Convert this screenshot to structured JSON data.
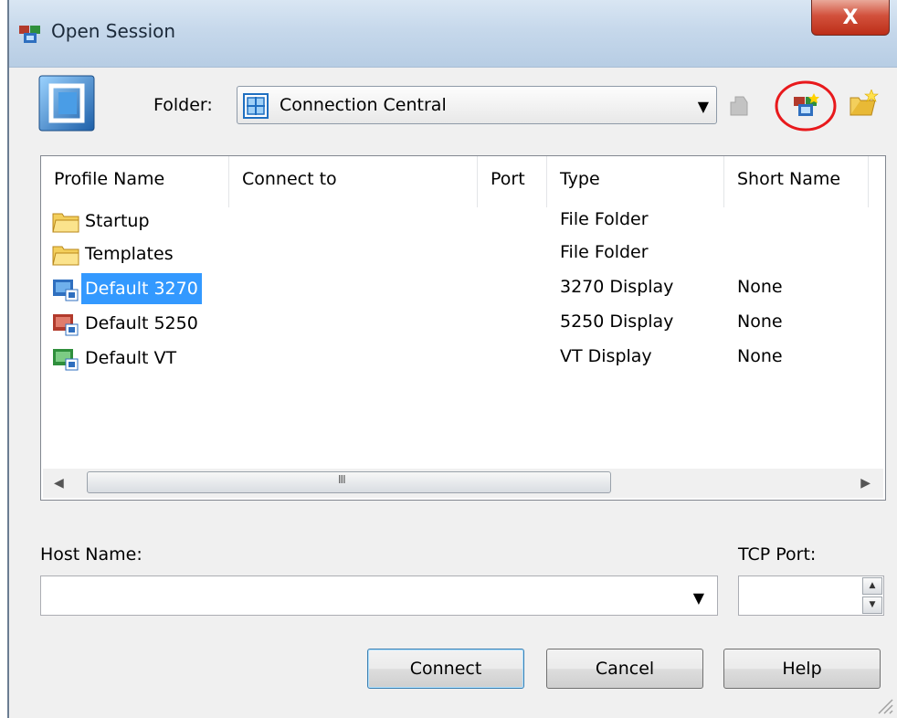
{
  "window": {
    "title": "Open Session",
    "close_label": "X"
  },
  "folder": {
    "label": "Folder:",
    "selected": "Connection Central"
  },
  "toolbar": {
    "icons": [
      "up-folder-icon",
      "new-session-icon",
      "new-folder-icon"
    ],
    "highlighted": "new-session-icon",
    "highlight_color": "#e8191c"
  },
  "list": {
    "columns": [
      "Profile Name",
      "Connect to",
      "Port",
      "Type",
      "Short Name"
    ],
    "rows": [
      {
        "name": "Startup",
        "connect_to": "",
        "port": "",
        "type": "File Folder",
        "short_name": "",
        "icon": "folder-icon"
      },
      {
        "name": "Templates",
        "connect_to": "",
        "port": "",
        "type": "File Folder",
        "short_name": "",
        "icon": "folder-icon"
      },
      {
        "name": "Default 3270",
        "connect_to": "",
        "port": "",
        "type": "3270 Display",
        "short_name": "None",
        "icon": "session-3270-icon",
        "selected": true
      },
      {
        "name": "Default 5250",
        "connect_to": "",
        "port": "",
        "type": "5250 Display",
        "short_name": "None",
        "icon": "session-5250-icon"
      },
      {
        "name": "Default VT",
        "connect_to": "",
        "port": "",
        "type": "VT Display",
        "short_name": "None",
        "icon": "session-vt-icon"
      }
    ],
    "scroll_grip": "III"
  },
  "host": {
    "label": "Host Name:",
    "value": ""
  },
  "tcp_port": {
    "label": "TCP Port:",
    "value": ""
  },
  "buttons": {
    "connect": "Connect",
    "cancel": "Cancel",
    "help": "Help"
  },
  "colors": {
    "selection": "#3399ff",
    "session_3270": "#2f6fbf",
    "session_5250": "#b23a2c",
    "session_vt": "#2f8f3c"
  }
}
